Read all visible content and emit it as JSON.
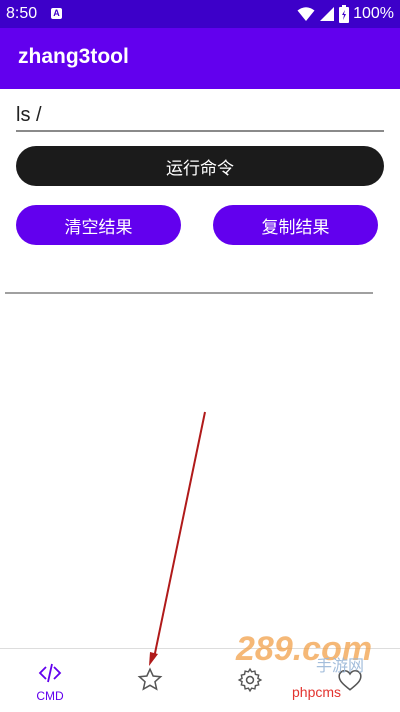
{
  "status_bar": {
    "time": "8:50",
    "battery": "100%",
    "notification_icon": "a-icon"
  },
  "app_bar": {
    "title": "zhang3tool"
  },
  "command": {
    "value": "ls /"
  },
  "buttons": {
    "run": "运行命令",
    "clear": "清空结果",
    "copy": "复制结果"
  },
  "bottom_nav": {
    "items": [
      {
        "icon": "code-icon",
        "label": "CMD",
        "active": true
      },
      {
        "icon": "star-icon",
        "label": ""
      },
      {
        "icon": "gear-icon",
        "label": ""
      },
      {
        "icon": "heart-icon",
        "label": ""
      }
    ]
  },
  "watermark": {
    "logo": "289.com",
    "cn_text": "手游网",
    "php_text": "phpcms"
  },
  "colors": {
    "status_bar": "#3d00c9",
    "primary": "#6200ee",
    "run_button": "#1b1b1b",
    "annotation_arrow": "#b01a1a"
  }
}
